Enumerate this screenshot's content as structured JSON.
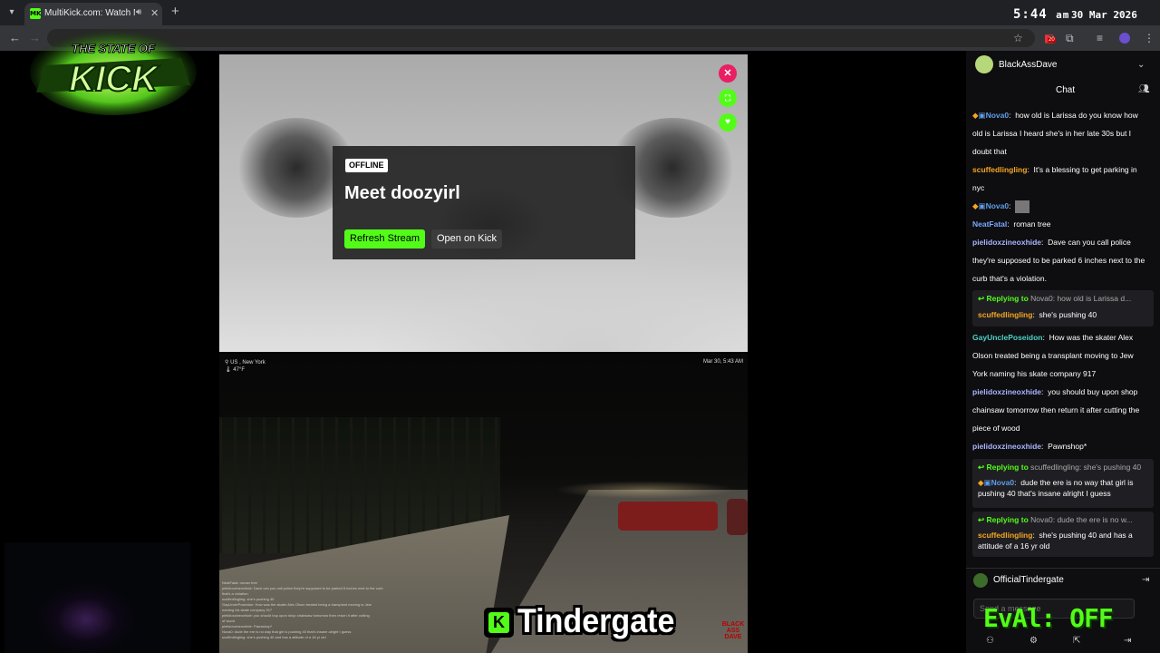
{
  "browser": {
    "tab_title": "MultiKick.com: Watch Multi",
    "tab_favicon": "MK",
    "clock_time": "5:44",
    "clock_ampm": "am",
    "clock_date": "30 Mar 2026",
    "ext_badge": "20"
  },
  "overlay": {
    "logo_top": "THE STATE OF",
    "logo_main": "KICK",
    "caption": "Tindergate",
    "kick_letter": "K",
    "eval_status": "EvAl: OFF",
    "corner_logo": "BLACK ASS DAVE"
  },
  "stream_card": {
    "badge": "OFFLINE",
    "title": "Meet doozyirl",
    "refresh_label": "Refresh Stream",
    "open_label": "Open on Kick"
  },
  "stream2": {
    "location": "US , New York",
    "temp": "47°F",
    "timestamp": "Mar 30, 5:43 AM"
  },
  "chat": {
    "channel": "BlackAssDave",
    "title": "Chat",
    "footer_user": "OfficialTindergate",
    "input_placeholder": "Send a message",
    "messages": [
      {
        "user": "Nova0",
        "color": "#5f9ee8",
        "text": "how old is Larissa do you know how old is Larissa I heard she's in her late 30s but I doubt that"
      },
      {
        "user": "scuffedlingling",
        "color": "#f5a623",
        "text": "It's a blessing to get parking in nyc"
      },
      {
        "user": "Nova0",
        "color": "#5f9ee8",
        "text": ""
      },
      {
        "user": "NeatFatal",
        "color": "#7aa7ff",
        "text": "roman tree"
      },
      {
        "user": "pielidoxzineoxhide",
        "color": "#a8b4ff",
        "text": "Dave can you call police they're supposed to be parked 6 inches next to the curb that's a violation."
      },
      {
        "user": "GayUnclePoseidon",
        "color": "#4fd1c5",
        "text": "How was the skater Alex Olson treated being a transplant moving to Jew York naming his skate company 917"
      },
      {
        "user": "pielidoxzineoxhide",
        "color": "#a8b4ff",
        "text": "you should buy upon shop chainsaw tomorrow then return it after cutting the piece of wood"
      },
      {
        "user": "pielidoxzineoxhide",
        "color": "#a8b4ff",
        "text": "Pawnshop*"
      }
    ],
    "replies": [
      {
        "label": "Replying to",
        "to": "Nova0",
        "quote": "how old is Larissa d...",
        "user": "scuffedlingling",
        "color": "#f5a623",
        "text": "she's pushing 40"
      },
      {
        "label": "Replying to",
        "to": "scuffedlingling",
        "quote": "she's pushing 40",
        "user": "Nova0",
        "color": "#5f9ee8",
        "text": "dude the ere is no way that girl is pushing 40 that's insane alright I guess"
      },
      {
        "label": "Replying to",
        "to": "Nova0",
        "quote": "dude the ere is no w...",
        "user": "scuffedlingling",
        "color": "#f5a623",
        "text": "she's pushing 40 and has a attitude of a 16 yr old"
      }
    ]
  },
  "overlay_chat_lines": [
    "NeatFatal: roman tree",
    "pielidoxzineoxhide: Dave can you call police they're supposed to be parked 6 inches next to the curb",
    "that's a violation.",
    "scuffedlingling: she's pushing 40",
    "GayUnclePoseidon: How was the skater Alex Olson treated being a transplant moving to Jew",
    "naming his skate company 917",
    "pielidoxzineoxhide: you should buy upon shop chainsaw tomorrow then return it after cutting",
    "of wood",
    "pielidoxzineoxhide: Pawnshop*",
    "Nova0: dude the ere is no way that girl is pushing 40 that's insane alright I guess",
    "scuffedlingling: she's pushing 40 and has a attitude of a 16 yr old"
  ]
}
